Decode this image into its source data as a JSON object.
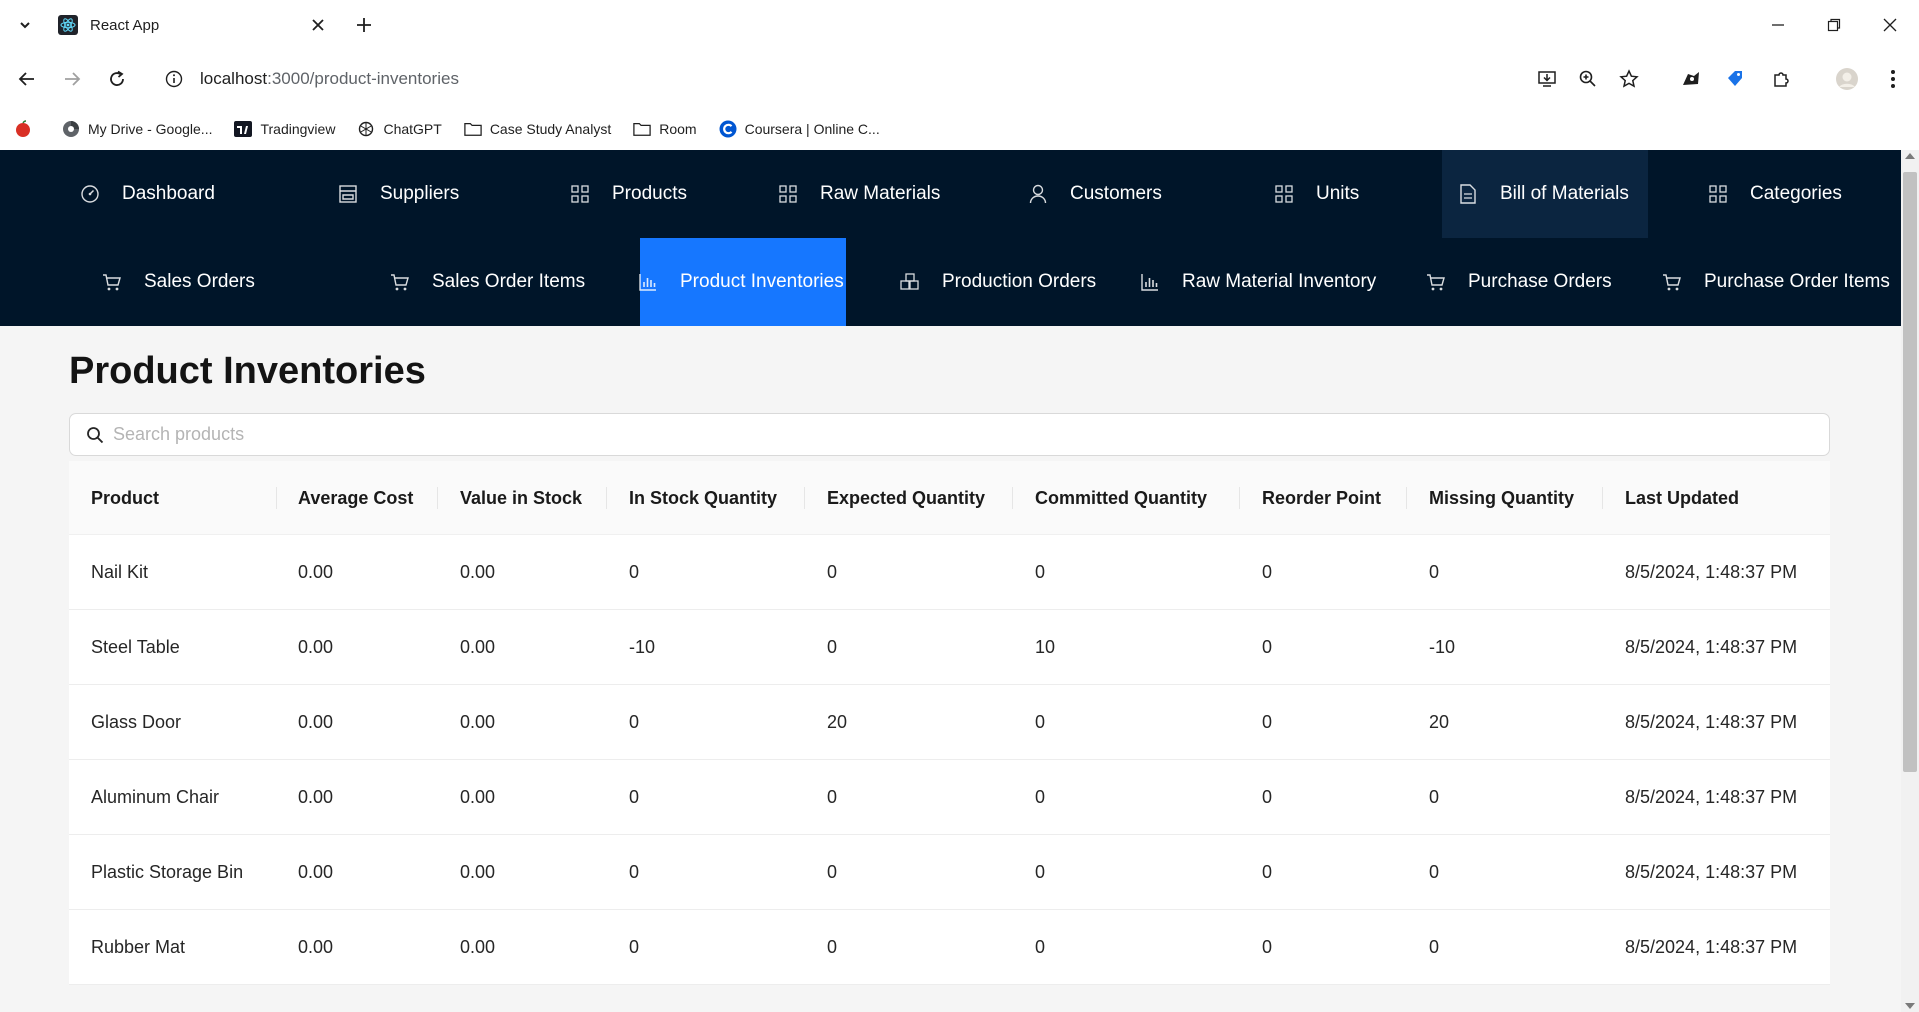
{
  "browser": {
    "tab_title": "React App",
    "url_host": "localhost",
    "url_path": ":3000/product-inventories",
    "bookmarks": [
      {
        "label": "My Drive - Google...",
        "icon": "drive-icon"
      },
      {
        "label": "Tradingview",
        "icon": "tradingview-icon"
      },
      {
        "label": "ChatGPT",
        "icon": "chatgpt-icon"
      },
      {
        "label": "Case Study Analyst",
        "icon": "folder-icon"
      },
      {
        "label": "Room",
        "icon": "folder-icon"
      },
      {
        "label": "Coursera | Online C...",
        "icon": "coursera-icon"
      }
    ]
  },
  "nav": {
    "row1": [
      {
        "label": "Dashboard",
        "icon": "dashboard-icon"
      },
      {
        "label": "Suppliers",
        "icon": "shop-icon"
      },
      {
        "label": "Products",
        "icon": "appstore-icon"
      },
      {
        "label": "Raw Materials",
        "icon": "appstore-icon"
      },
      {
        "label": "Customers",
        "icon": "user-icon"
      },
      {
        "label": "Units",
        "icon": "appstore-icon"
      },
      {
        "label": "Bill of Materials",
        "icon": "file-icon"
      },
      {
        "label": "Categories",
        "icon": "appstore-icon"
      }
    ],
    "row2": [
      {
        "label": "Sales Orders",
        "icon": "cart-icon"
      },
      {
        "label": "Sales Order Items",
        "icon": "cart-icon"
      },
      {
        "label": "Product Inventories",
        "icon": "bar-chart-icon"
      },
      {
        "label": "Production Orders",
        "icon": "build-icon"
      },
      {
        "label": "Raw Material Inventory",
        "icon": "bar-chart-icon"
      },
      {
        "label": "Purchase Orders",
        "icon": "cart-icon"
      },
      {
        "label": "Purchase Order Items",
        "icon": "cart-icon"
      }
    ],
    "active_color": "#1677ff",
    "bg_color": "#001529"
  },
  "page": {
    "title": "Product Inventories",
    "search_placeholder": "Search products"
  },
  "table": {
    "columns": [
      "Product",
      "Average Cost",
      "Value in Stock",
      "In Stock Quantity",
      "Expected Quantity",
      "Committed Quantity",
      "Reorder Point",
      "Missing Quantity",
      "Last Updated"
    ],
    "rows": [
      [
        "Nail Kit",
        "0.00",
        "0.00",
        "0",
        "0",
        "0",
        "0",
        "0",
        "8/5/2024, 1:48:37 PM"
      ],
      [
        "Steel Table",
        "0.00",
        "0.00",
        "-10",
        "0",
        "10",
        "0",
        "-10",
        "8/5/2024, 1:48:37 PM"
      ],
      [
        "Glass Door",
        "0.00",
        "0.00",
        "0",
        "20",
        "0",
        "0",
        "20",
        "8/5/2024, 1:48:37 PM"
      ],
      [
        "Aluminum Chair",
        "0.00",
        "0.00",
        "0",
        "0",
        "0",
        "0",
        "0",
        "8/5/2024, 1:48:37 PM"
      ],
      [
        "Plastic Storage Bin",
        "0.00",
        "0.00",
        "0",
        "0",
        "0",
        "0",
        "0",
        "8/5/2024, 1:48:37 PM"
      ],
      [
        "Rubber Mat",
        "0.00",
        "0.00",
        "0",
        "0",
        "0",
        "0",
        "0",
        "8/5/2024, 1:48:37 PM"
      ]
    ]
  }
}
